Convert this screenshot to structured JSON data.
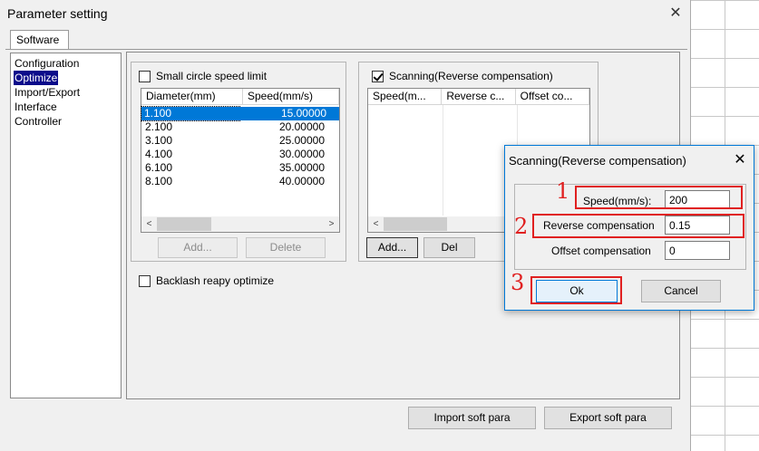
{
  "window": {
    "title": "Parameter setting",
    "close_glyph": "✕"
  },
  "tabs": [
    {
      "label": "Software"
    }
  ],
  "sidebar": {
    "items": [
      {
        "label": "Configuration"
      },
      {
        "label": "Optimize"
      },
      {
        "label": "Import/Export"
      },
      {
        "label": "Interface"
      },
      {
        "label": "Controller"
      }
    ]
  },
  "small_circle": {
    "checkbox_label": "Small circle speed limit",
    "checked": false,
    "columns": [
      "Diameter(mm)",
      "Speed(mm/s)"
    ],
    "rows": [
      [
        "1.100",
        "15.00000"
      ],
      [
        "2.100",
        "20.00000"
      ],
      [
        "3.100",
        "25.00000"
      ],
      [
        "4.100",
        "30.00000"
      ],
      [
        "6.100",
        "35.00000"
      ],
      [
        "8.100",
        "40.00000"
      ]
    ],
    "add_label": "Add...",
    "delete_label": "Delete"
  },
  "scanning": {
    "checkbox_label": "Scanning(Reverse compensation)",
    "checked": true,
    "columns": [
      "Speed(m...",
      "Reverse c...",
      "Offset co..."
    ],
    "add_label": "Add...",
    "del_label": "Del"
  },
  "backlash": {
    "checkbox_label": "Backlash reapy optimize",
    "checked": false
  },
  "footer": {
    "import_label": "Import soft para",
    "export_label": "Export soft para"
  },
  "dialog": {
    "title": "Scanning(Reverse compensation)",
    "close_glyph": "✕",
    "speed_label": "Speed(mm/s):",
    "speed_value": "200",
    "reverse_label": "Reverse compensation",
    "reverse_value": "0.15",
    "offset_label": "Offset compensation",
    "offset_value": "0",
    "ok_label": "Ok",
    "cancel_label": "Cancel"
  },
  "annotations": {
    "marker_1": "1",
    "marker_2": "2",
    "marker_3": "3",
    "color": "#e02020"
  },
  "colors": {
    "selection": "#0078d7",
    "sidebar_selection": "#0a0a8a",
    "window_bg": "#f0f0f0"
  }
}
